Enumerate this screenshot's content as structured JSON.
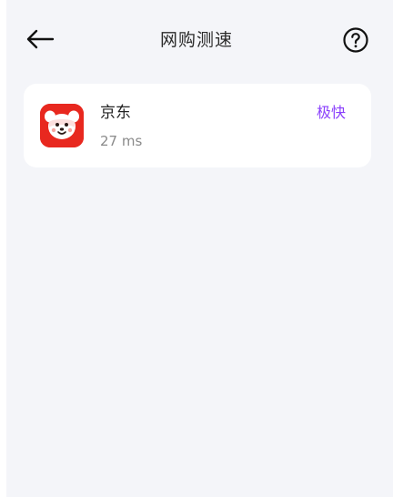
{
  "header": {
    "title": "网购测速",
    "back_icon": "arrow-left-icon",
    "help_icon": "question-circle-icon"
  },
  "results": [
    {
      "app_name": "京东",
      "latency": "27 ms",
      "speed_label": "极快",
      "icon": "jd-app-icon"
    }
  ],
  "colors": {
    "background": "#f4f5f9",
    "card": "#ffffff",
    "speed_accent": "#8a3ffc",
    "app_icon_red": "#e8281f",
    "secondary_text": "#8a8a8a"
  }
}
